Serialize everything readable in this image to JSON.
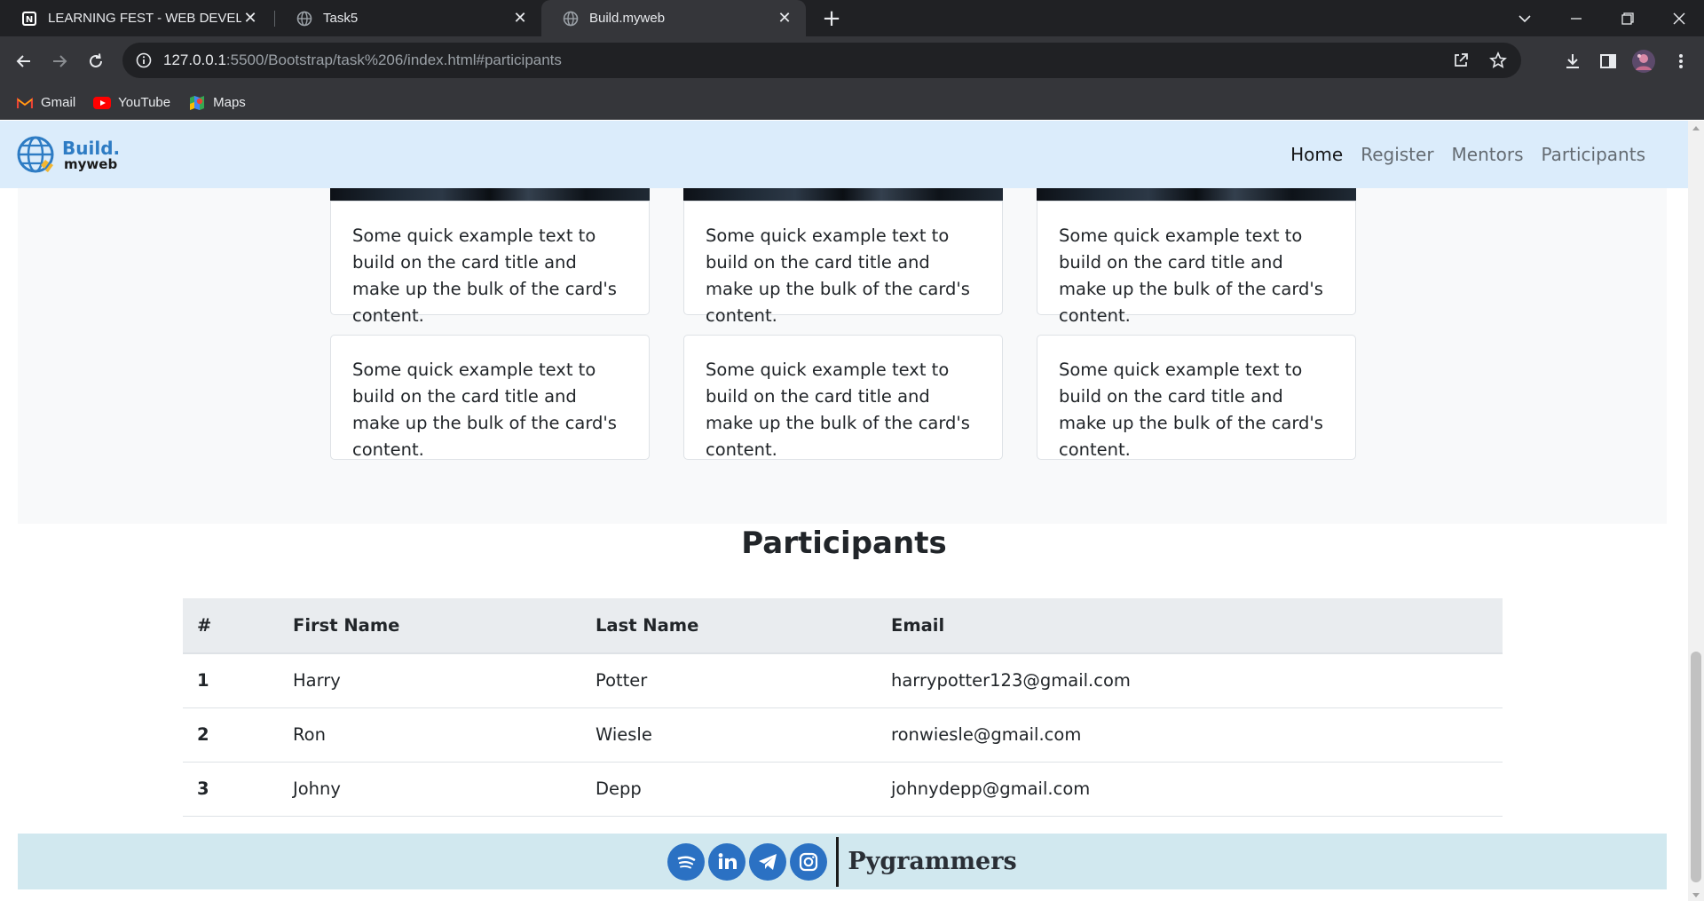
{
  "browser": {
    "tabs": [
      {
        "title": "LEARNING FEST - WEB DEVELOP",
        "favicon": "notion-icon"
      },
      {
        "title": "Task5",
        "favicon": "globe-icon"
      },
      {
        "title": "Build.myweb",
        "favicon": "globe-icon",
        "active": true
      }
    ],
    "url_host": "127.0.0.1",
    "url_rest": ":5500/Bootstrap/task%206/index.html#participants",
    "bookmarks": [
      {
        "label": "Gmail",
        "icon": "gmail-icon"
      },
      {
        "label": "YouTube",
        "icon": "youtube-icon"
      },
      {
        "label": "Maps",
        "icon": "maps-icon"
      }
    ]
  },
  "navbar": {
    "brand_line1": "Build.",
    "brand_line2": "myweb",
    "links": [
      "Home",
      "Register",
      "Mentors",
      "Participants"
    ],
    "active": "Home"
  },
  "cards": {
    "text": "Some quick example text to build on the card title and make up the bulk of the card's content."
  },
  "participants": {
    "title": "Participants",
    "columns": [
      "#",
      "First Name",
      "Last Name",
      "Email"
    ],
    "rows": [
      {
        "num": "1",
        "first": "Harry",
        "last": "Potter",
        "email": "harrypotter123@gmail.com"
      },
      {
        "num": "2",
        "first": "Ron",
        "last": "Wiesle",
        "email": "ronwiesle@gmail.com"
      },
      {
        "num": "3",
        "first": "Johny",
        "last": "Depp",
        "email": "johnydepp@gmail.com"
      }
    ]
  },
  "footer": {
    "name": "Pygrammers",
    "social": [
      "spotify-icon",
      "linkedin-icon",
      "telegram-icon",
      "instagram-icon"
    ]
  },
  "colors": {
    "navbar_bg": "#dbecfb",
    "footer_bg": "#d1e8ef",
    "brand_blue": "#2e7cc4",
    "social_blue": "#2b71c3"
  }
}
